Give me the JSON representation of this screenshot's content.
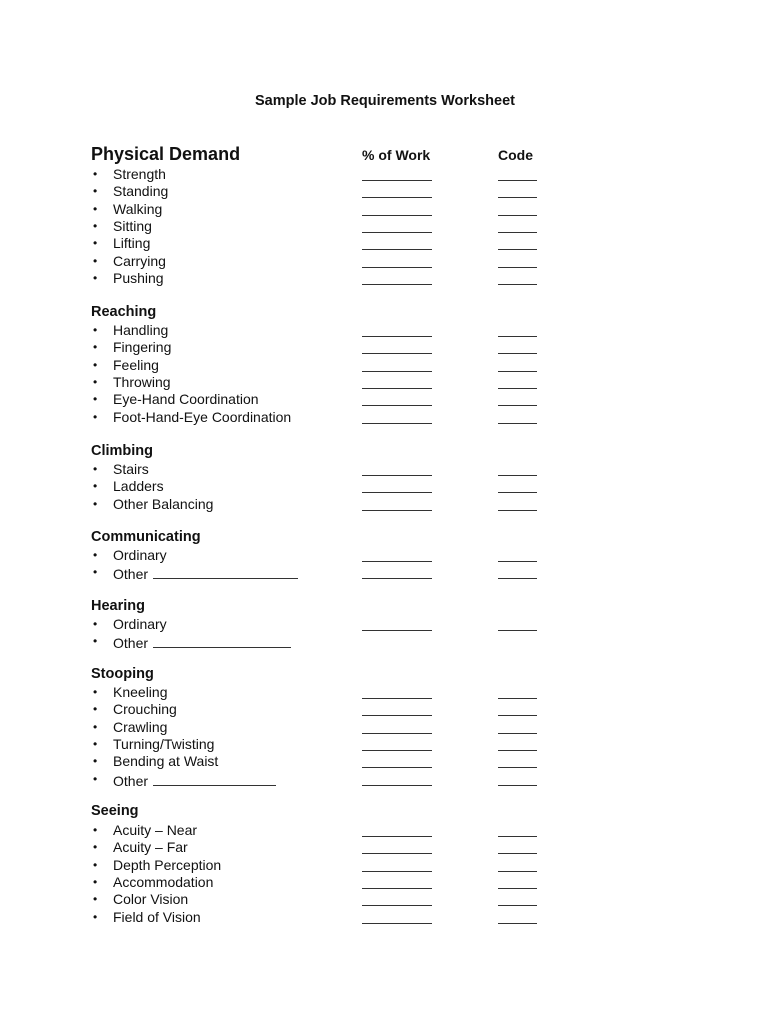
{
  "document": {
    "title": "Sample Job Requirements Worksheet",
    "columns": {
      "percent": "% of Work",
      "code": "Code"
    },
    "sections": [
      {
        "title": "Physical Demand",
        "items": [
          {
            "label": "Strength",
            "other_blank": false,
            "has_fields": true
          },
          {
            "label": "Standing",
            "other_blank": false,
            "has_fields": true
          },
          {
            "label": "Walking",
            "other_blank": false,
            "has_fields": true
          },
          {
            "label": "Sitting",
            "other_blank": false,
            "has_fields": true
          },
          {
            "label": "Lifting",
            "other_blank": false,
            "has_fields": true
          },
          {
            "label": "Carrying",
            "other_blank": false,
            "has_fields": true
          },
          {
            "label": "Pushing",
            "other_blank": false,
            "has_fields": true
          }
        ]
      },
      {
        "title": "Reaching",
        "items": [
          {
            "label": "Handling",
            "other_blank": false,
            "has_fields": true
          },
          {
            "label": "Fingering",
            "other_blank": false,
            "has_fields": true
          },
          {
            "label": "Feeling",
            "other_blank": false,
            "has_fields": true
          },
          {
            "label": "Throwing",
            "other_blank": false,
            "has_fields": true
          },
          {
            "label": "Eye-Hand Coordination",
            "other_blank": false,
            "has_fields": true
          },
          {
            "label": "Foot-Hand-Eye Coordination",
            "other_blank": false,
            "has_fields": true
          }
        ]
      },
      {
        "title": "Climbing",
        "items": [
          {
            "label": "Stairs",
            "other_blank": false,
            "has_fields": true
          },
          {
            "label": "Ladders",
            "other_blank": false,
            "has_fields": true
          },
          {
            "label": "Other Balancing",
            "other_blank": false,
            "has_fields": true
          }
        ]
      },
      {
        "title": "Communicating",
        "items": [
          {
            "label": "Ordinary",
            "other_blank": false,
            "has_fields": true
          },
          {
            "label": "Other",
            "other_blank": true,
            "has_fields": true
          }
        ]
      },
      {
        "title": "Hearing",
        "items": [
          {
            "label": "Ordinary",
            "other_blank": false,
            "has_fields": true
          },
          {
            "label": "Other",
            "other_blank": true,
            "has_fields": false
          }
        ]
      },
      {
        "title": "Stooping",
        "items": [
          {
            "label": "Kneeling",
            "other_blank": false,
            "has_fields": true
          },
          {
            "label": "Crouching",
            "other_blank": false,
            "has_fields": true
          },
          {
            "label": "Crawling",
            "other_blank": false,
            "has_fields": true
          },
          {
            "label": "Turning/Twisting",
            "other_blank": false,
            "has_fields": true
          },
          {
            "label": "Bending at Waist",
            "other_blank": false,
            "has_fields": true
          },
          {
            "label": "Other",
            "other_blank": true,
            "has_fields": true
          }
        ]
      },
      {
        "title": "Seeing",
        "items": [
          {
            "label": "Acuity – Near",
            "other_blank": false,
            "has_fields": true
          },
          {
            "label": "Acuity – Far",
            "other_blank": false,
            "has_fields": true
          },
          {
            "label": "Depth Perception",
            "other_blank": false,
            "has_fields": true
          },
          {
            "label": "Accommodation",
            "other_blank": false,
            "has_fields": true
          },
          {
            "label": "Color Vision",
            "other_blank": false,
            "has_fields": true
          },
          {
            "label": "Field of Vision",
            "other_blank": false,
            "has_fields": true
          }
        ]
      }
    ],
    "bullet_glyph": "•"
  }
}
